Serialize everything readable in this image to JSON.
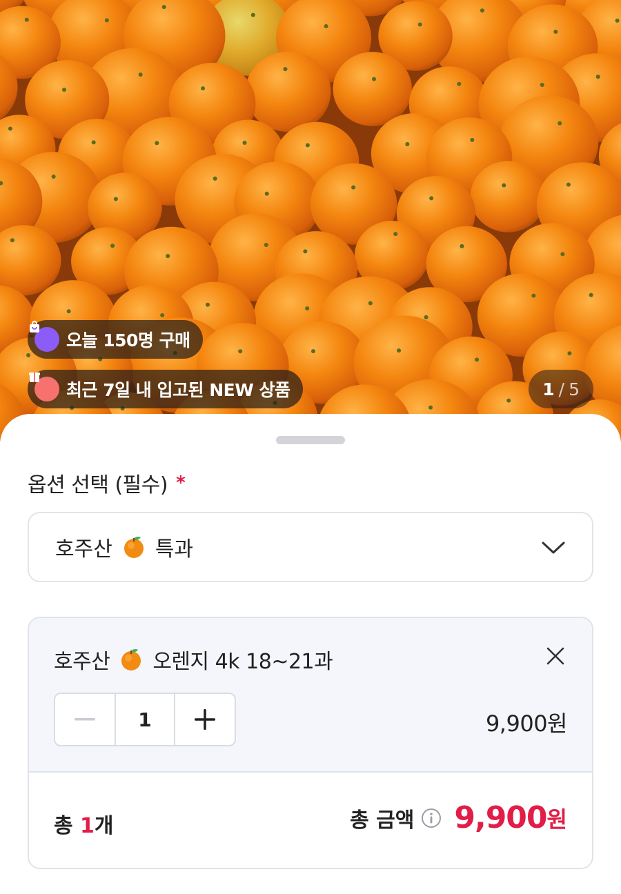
{
  "badges": {
    "today_purchases": "오늘 150명 구매",
    "new_arrival": "최근 7일 내 입고된 NEW 상품"
  },
  "gallery": {
    "current": "1",
    "separator": "/",
    "total": "5"
  },
  "option": {
    "title": "옵션 선택 (필수)",
    "required_mark": "*",
    "selected_prefix": "호주산",
    "selected_suffix": "특과"
  },
  "cart_item": {
    "name_prefix": "호주산",
    "name_suffix": "오렌지 4k 18~21과",
    "quantity": "1",
    "price": "9,900원"
  },
  "summary": {
    "count_prefix": "총 ",
    "count_value": "1",
    "count_suffix": "개",
    "total_label": "총 금액",
    "total_value": "9,900",
    "total_unit": "원"
  },
  "colors": {
    "accent_red": "#e11d48",
    "today_badge_icon": "#8b5cf6",
    "new_badge_icon": "#f87171"
  },
  "icons": {
    "today_badge": "shopping-bag-icon",
    "new_badge": "gift-box-icon",
    "dropdown": "chevron-down-icon",
    "remove": "close-icon",
    "decrease": "minus-icon",
    "increase": "plus-icon",
    "info": "info-icon",
    "emoji": "tangerine-emoji-icon"
  }
}
